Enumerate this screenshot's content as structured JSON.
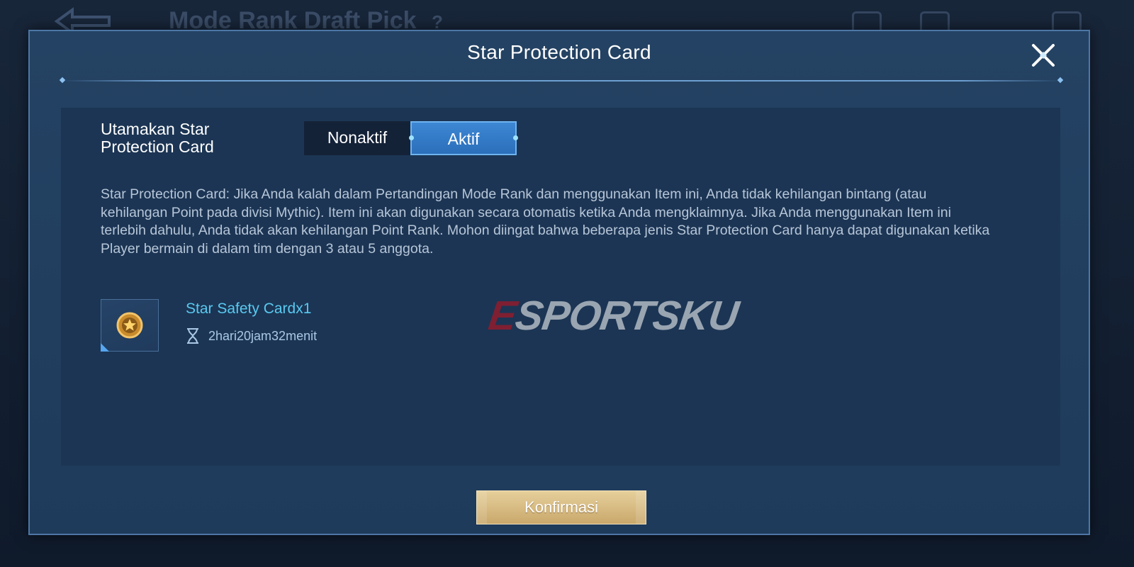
{
  "background": {
    "page_title": "Mode Rank Draft Pick",
    "help_mark": "?"
  },
  "modal": {
    "title": "Star Protection Card",
    "preference": {
      "label": "Utamakan Star Protection Card",
      "options": [
        {
          "label": "Nonaktif",
          "selected": false
        },
        {
          "label": "Aktif",
          "selected": true
        }
      ]
    },
    "description": "Star Protection Card: Jika Anda kalah dalam Pertandingan Mode Rank dan menggunakan Item ini, Anda tidak kehilangan bintang (atau kehilangan Point pada divisi Mythic). Item ini akan digunakan secara otomatis ketika Anda mengklaimnya. Jika Anda menggunakan Item ini terlebih dahulu, Anda tidak akan kehilangan Point Rank. Mohon diingat bahwa beberapa jenis Star Protection Card hanya dapat digunakan ketika Player bermain di dalam tim dengan 3 atau 5 anggota.",
    "item": {
      "name": "Star Safety Cardx1",
      "icon": "star-medal-icon",
      "timer_icon": "hourglass-icon",
      "time_left": "2hari20jam32menit"
    },
    "confirm_label": "Konfirmasi"
  },
  "watermark": {
    "first_letter": "E",
    "rest": "SPORTSKU"
  },
  "colors": {
    "accent_blue": "#2b6fba",
    "item_name": "#59c9f0",
    "confirm_gold": "#c9a86b",
    "watermark_red": "#8a1d2f"
  }
}
